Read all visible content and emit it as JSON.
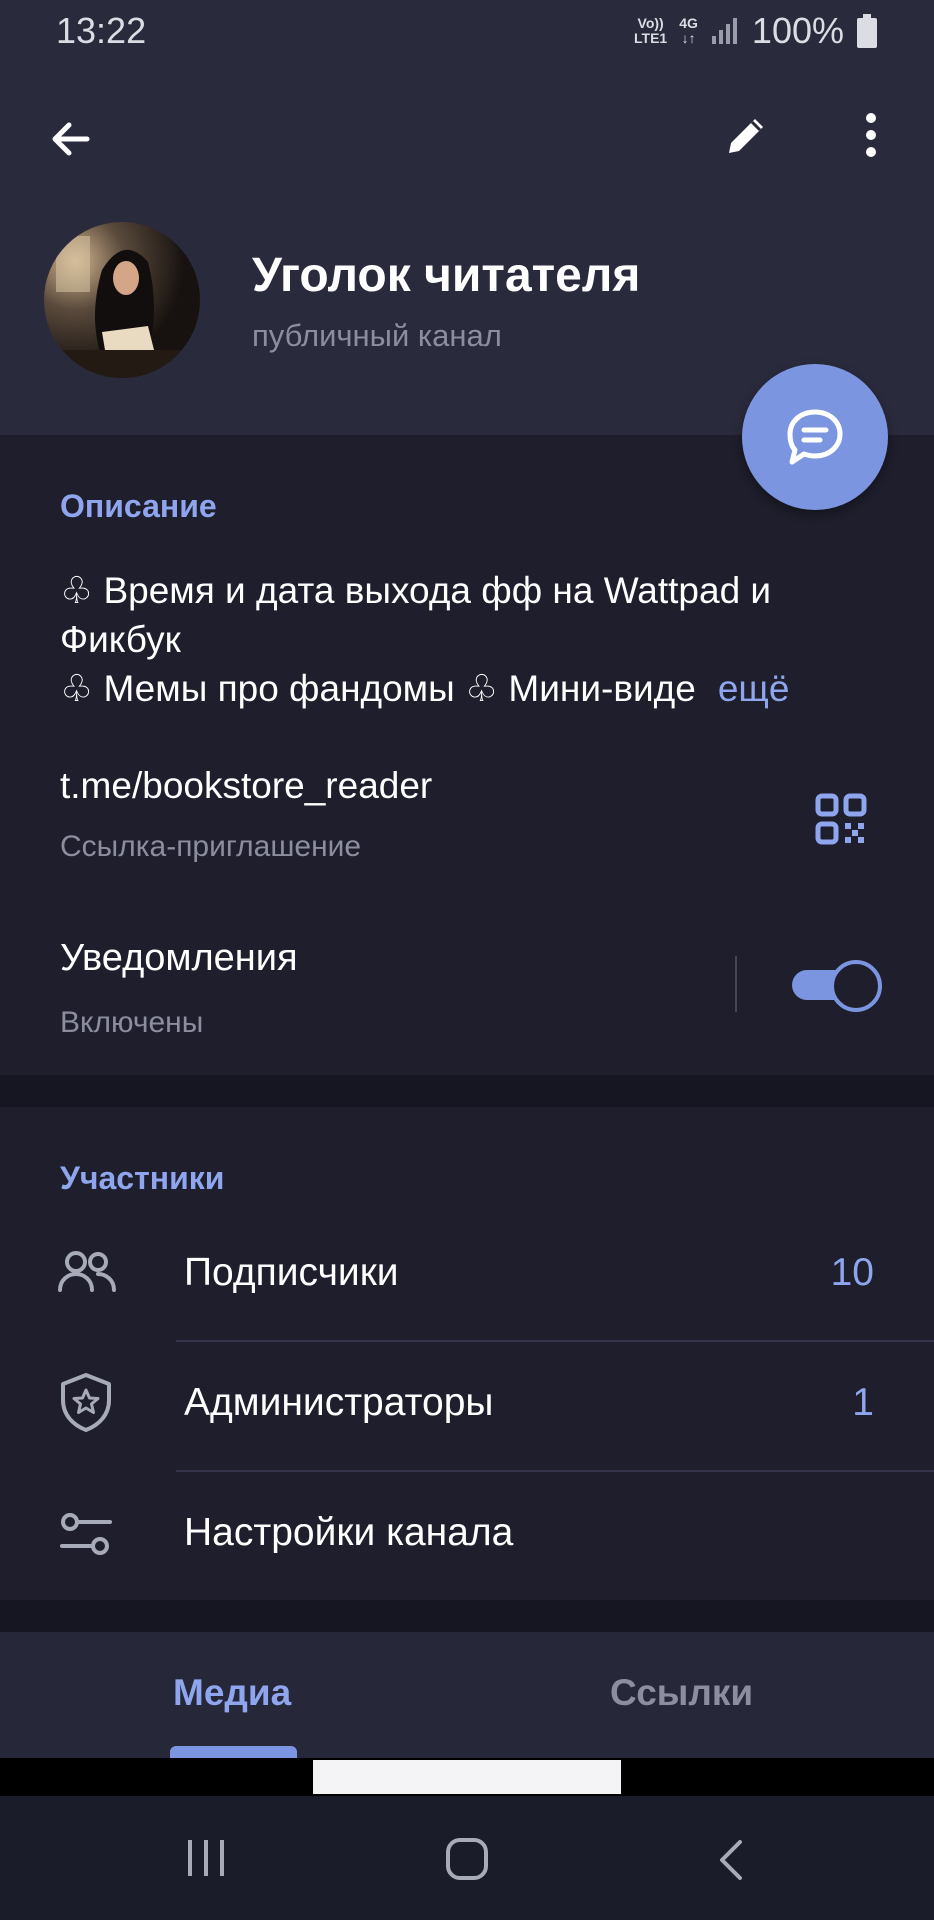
{
  "status_bar": {
    "time": "13:22",
    "volte": "Vo))",
    "lte": "LTE1",
    "network": "4G",
    "battery": "100%"
  },
  "toolbar": {
    "back_icon": "arrow-left-icon",
    "edit_icon": "pencil-icon",
    "more_icon": "more-vertical-icon"
  },
  "channel": {
    "name": "Уголок читателя",
    "type": "публичный канал"
  },
  "description": {
    "section_title": "Описание",
    "line1": "♧ Время и дата выхода фф на Wattpad и Фикбук",
    "line2": "♧ Мемы про фандомы ♧ Мини-виде",
    "more": "ещё"
  },
  "link": {
    "url": "t.me/bookstore_reader",
    "label": "Ссылка-приглашение"
  },
  "notifications": {
    "title": "Уведомления",
    "status": "Включены",
    "enabled": true
  },
  "members": {
    "section_title": "Участники",
    "rows": [
      {
        "label": "Подписчики",
        "count": "10",
        "icon": "users-icon"
      },
      {
        "label": "Администраторы",
        "count": "1",
        "icon": "shield-star-icon"
      },
      {
        "label": "Настройки канала",
        "count": "",
        "icon": "settings-sliders-icon"
      }
    ]
  },
  "tabs": [
    {
      "label": "Медиа",
      "active": true
    },
    {
      "label": "Ссылки",
      "active": false
    }
  ],
  "colors": {
    "accent": "#7c95e0",
    "accent_text": "#8fa6ef",
    "background": "#1e1e2c",
    "header": "#292a3c"
  }
}
